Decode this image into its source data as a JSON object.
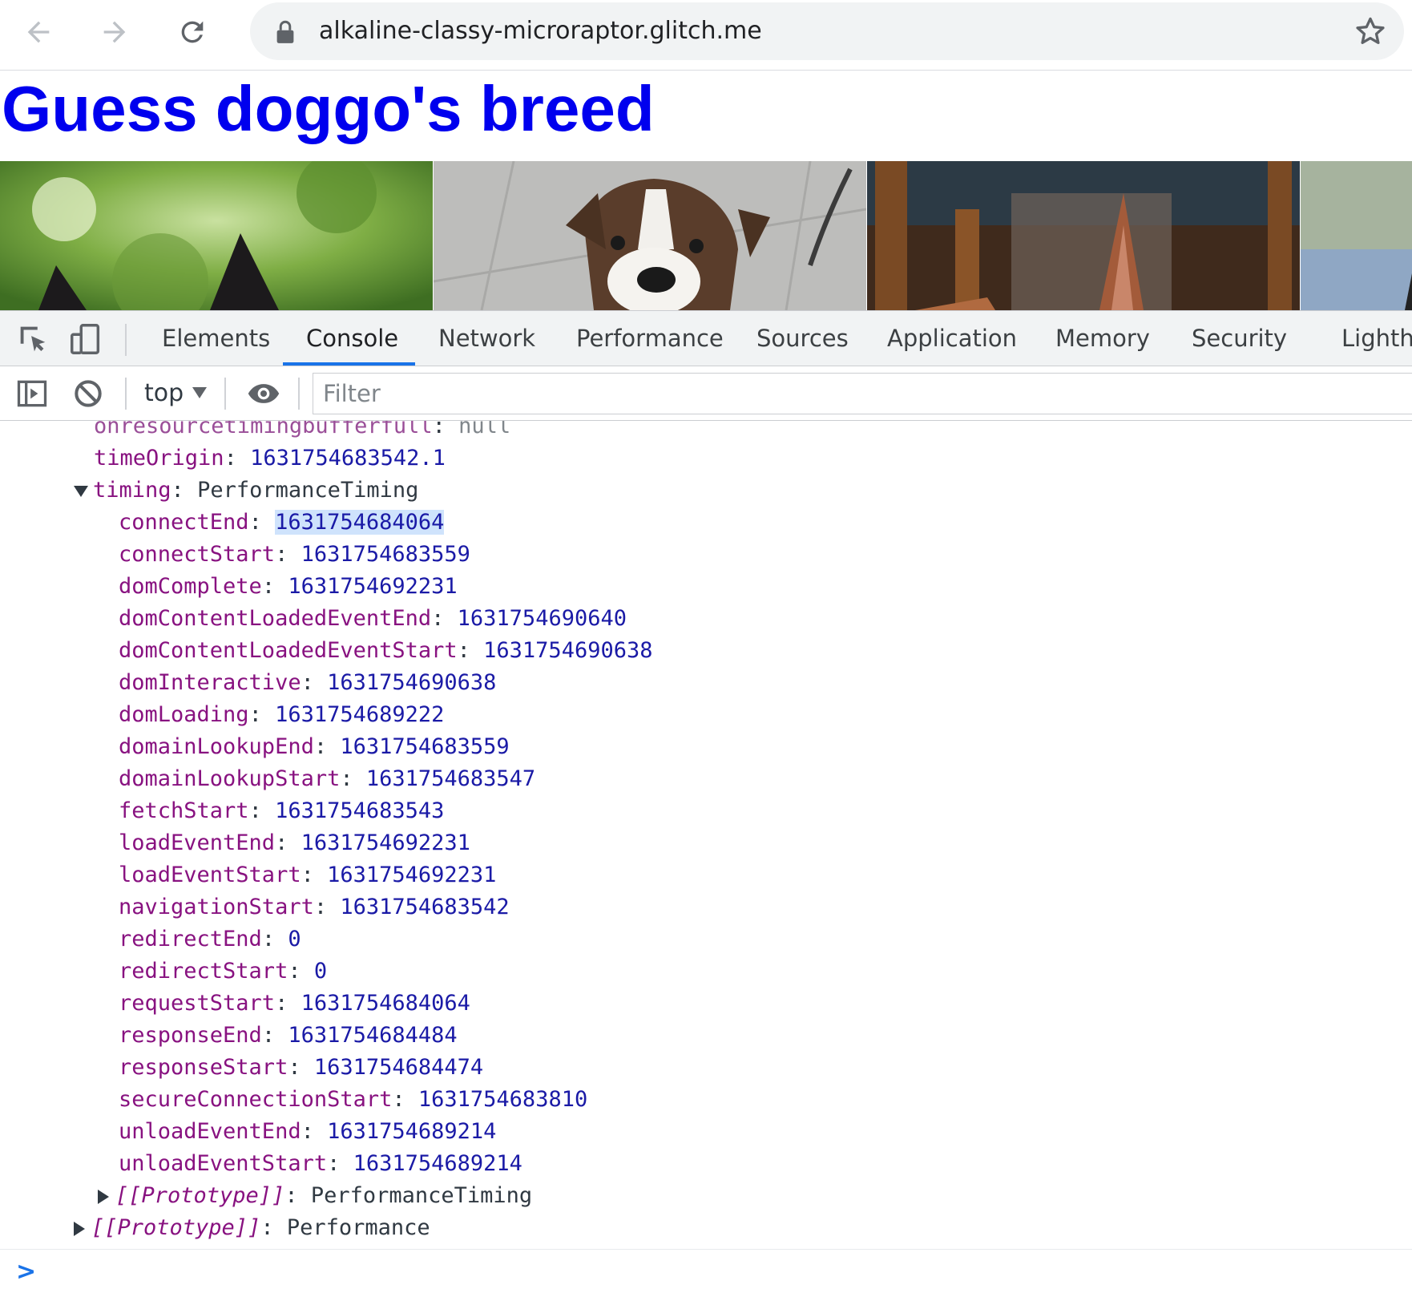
{
  "browser": {
    "url": "alkaline-classy-microraptor.glitch.me",
    "icons": [
      "back-arrow-icon",
      "forward-arrow-icon",
      "reload-icon",
      "lock-icon",
      "star-icon"
    ]
  },
  "page": {
    "title": "Guess doggo's breed"
  },
  "devtools": {
    "tabs": [
      {
        "label": "Elements",
        "active": false
      },
      {
        "label": "Console",
        "active": true
      },
      {
        "label": "Network",
        "active": false
      },
      {
        "label": "Performance",
        "active": false
      },
      {
        "label": "Sources",
        "active": false
      },
      {
        "label": "Application",
        "active": false
      },
      {
        "label": "Memory",
        "active": false
      },
      {
        "label": "Security",
        "active": false
      },
      {
        "label": "Lightho",
        "active": false
      }
    ],
    "accent_color": "#1a73e8"
  },
  "console_bar": {
    "context": "top",
    "filter_placeholder": "Filter",
    "filter_value": ""
  },
  "console": {
    "top_lines": [
      {
        "key": "onresourcetimingbufferfull",
        "value": "null",
        "kind": "null"
      },
      {
        "key": "timeOrigin",
        "value": "1631754683542.1",
        "kind": "num"
      }
    ],
    "timing": {
      "key": "timing",
      "type": "PerformanceTiming",
      "entries": [
        {
          "key": "connectEnd",
          "value": "1631754684064",
          "highlighted": true
        },
        {
          "key": "connectStart",
          "value": "1631754683559"
        },
        {
          "key": "domComplete",
          "value": "1631754692231"
        },
        {
          "key": "domContentLoadedEventEnd",
          "value": "1631754690640"
        },
        {
          "key": "domContentLoadedEventStart",
          "value": "1631754690638"
        },
        {
          "key": "domInteractive",
          "value": "1631754690638"
        },
        {
          "key": "domLoading",
          "value": "1631754689222"
        },
        {
          "key": "domainLookupEnd",
          "value": "1631754683559"
        },
        {
          "key": "domainLookupStart",
          "value": "1631754683547"
        },
        {
          "key": "fetchStart",
          "value": "1631754683543"
        },
        {
          "key": "loadEventEnd",
          "value": "1631754692231"
        },
        {
          "key": "loadEventStart",
          "value": "1631754692231"
        },
        {
          "key": "navigationStart",
          "value": "1631754683542"
        },
        {
          "key": "redirectEnd",
          "value": "0"
        },
        {
          "key": "redirectStart",
          "value": "0"
        },
        {
          "key": "requestStart",
          "value": "1631754684064"
        },
        {
          "key": "responseEnd",
          "value": "1631754684484"
        },
        {
          "key": "responseStart",
          "value": "1631754684474"
        },
        {
          "key": "secureConnectionStart",
          "value": "1631754683810"
        },
        {
          "key": "unloadEventEnd",
          "value": "1631754689214"
        },
        {
          "key": "unloadEventStart",
          "value": "1631754689214"
        }
      ],
      "prototype": {
        "key": "[[Prototype]]",
        "value": "PerformanceTiming"
      }
    },
    "outer_prototype": {
      "key": "[[Prototype]]",
      "value": "Performance"
    },
    "prompt_symbol": ">"
  }
}
